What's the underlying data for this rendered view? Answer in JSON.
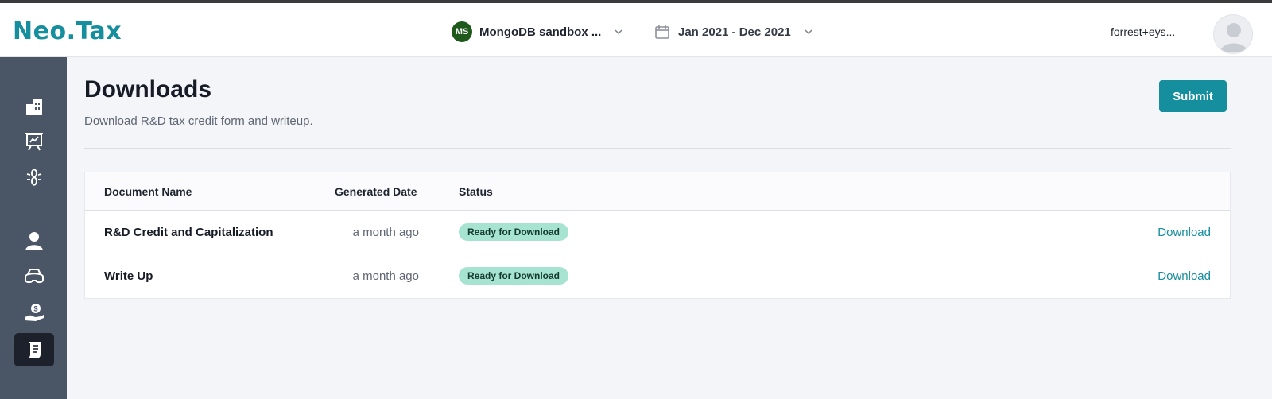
{
  "app": {
    "logo": "Neo.Tax"
  },
  "header": {
    "company": {
      "initials": "MS",
      "name": "MongoDB sandbox ...",
      "badge_color": "#1f5a1c",
      "chevron_icon": "chevron-down-icon"
    },
    "date_range": {
      "icon": "calendar-icon",
      "label": "Jan 2021 - Dec 2021",
      "chevron_icon": "chevron-down-icon"
    },
    "user": {
      "name": "forrest+eys...",
      "avatar_icon": "user-avatar-icon"
    }
  },
  "sidebar": {
    "items": [
      {
        "icon": "building-icon",
        "active": false
      },
      {
        "icon": "presentation-icon",
        "active": false
      },
      {
        "icon": "bug-icon",
        "active": false
      },
      {
        "icon": "person-icon",
        "active": false
      },
      {
        "icon": "goggles-icon",
        "active": false
      },
      {
        "icon": "hand-money-icon",
        "active": false
      },
      {
        "icon": "document-icon",
        "active": true
      }
    ]
  },
  "page": {
    "title": "Downloads",
    "subtitle": "Download R&D tax credit form and writeup.",
    "submit_label": "Submit"
  },
  "table": {
    "columns": [
      "Document Name",
      "Generated Date",
      "Status"
    ],
    "rows": [
      {
        "name": "R&D Credit and Capitalization",
        "date": "a month ago",
        "status": "Ready for Download",
        "action": "Download"
      },
      {
        "name": "Write Up",
        "date": "a month ago",
        "status": "Ready for Download",
        "action": "Download"
      }
    ]
  },
  "colors": {
    "accent": "#158e9e",
    "status_ready": "#a6e3d0",
    "sidebar": "#4a5566"
  }
}
